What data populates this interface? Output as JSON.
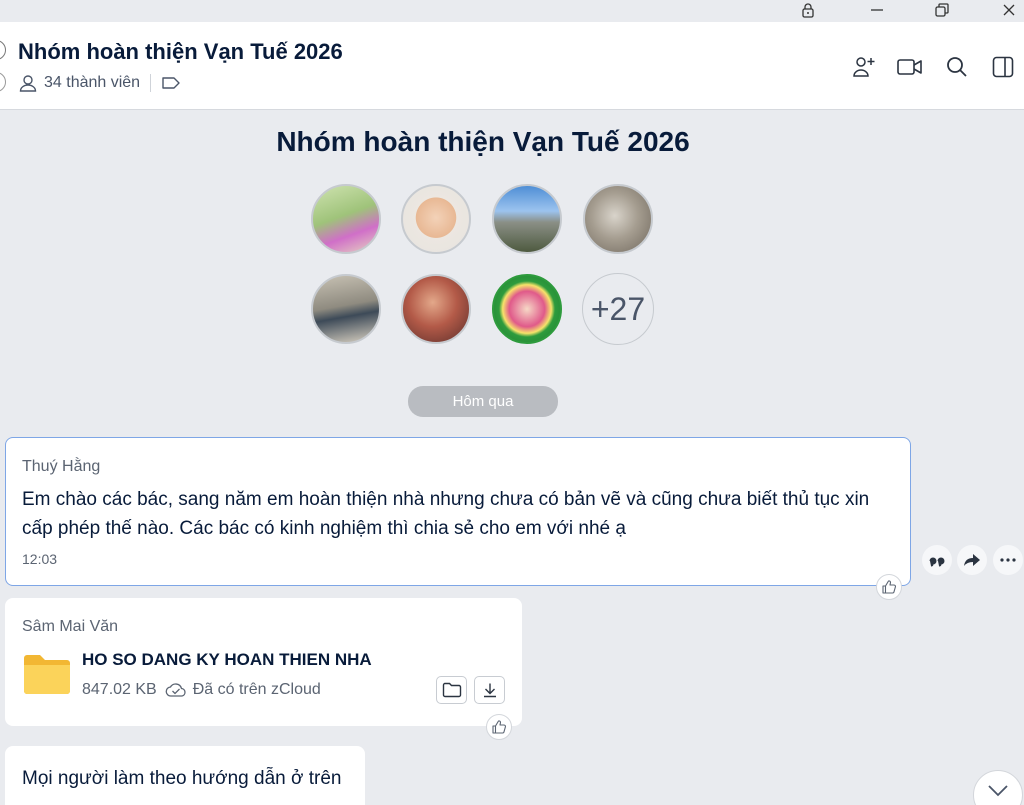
{
  "window": {
    "lock_icon": "lock-icon",
    "minimize_icon": "minimize-icon",
    "restore_icon": "restore-icon",
    "close_icon": "close-icon"
  },
  "header": {
    "title": "Nhóm hoàn thiện Vạn Tuế 2026",
    "member_count": "34 thành viên",
    "icons": [
      "add-member-icon",
      "video-call-icon",
      "search-icon",
      "sidebar-toggle-icon"
    ]
  },
  "intro": {
    "group_name": "Nhóm hoàn thiện Vạn Tuế 2026",
    "more_members": "+27"
  },
  "date_divider": "Hôm qua",
  "messages": [
    {
      "sender": "Thuý Hằng",
      "text_line1": "Em chào các bác, sang năm em hoàn thiện nhà nhưng chưa có bản vẽ và cũng chưa biết thủ tục xin",
      "text_line2": "cấp phép thế nào. Các bác có kinh nghiệm thì chia sẻ cho em với nhé ạ",
      "time": "12:03"
    },
    {
      "sender": "Sâm Mai Văn",
      "file_name": "HO SO DANG KY HOAN THIEN NHA",
      "file_size": "847.02 KB",
      "cloud_status": "Đã có trên zCloud"
    },
    {
      "text": "Mọi người làm theo hướng dẫn ở trên"
    }
  ],
  "colors": {
    "accent": "#7ea6e6",
    "background": "#e9ebef",
    "folder": "#f5c542"
  }
}
